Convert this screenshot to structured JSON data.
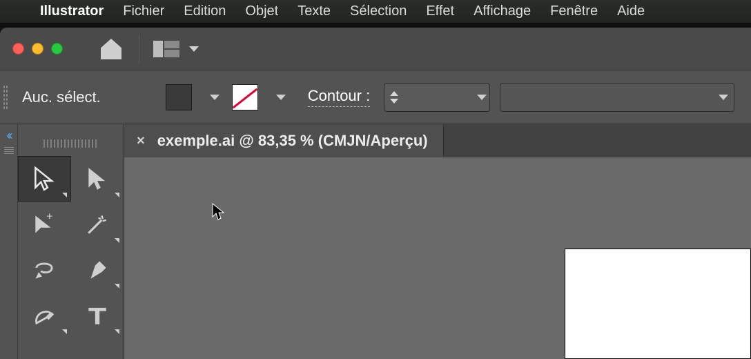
{
  "menubar": {
    "apple_glyph": "",
    "app_name": "Illustrator",
    "items": [
      "Fichier",
      "Edition",
      "Objet",
      "Texte",
      "Sélection",
      "Effet",
      "Affichage",
      "Fenêtre",
      "Aide"
    ]
  },
  "controlbar": {
    "selection_label": "Auc. sélect.",
    "contour_label": "Contour :"
  },
  "sidebar": {
    "collapse_glyph": "‹‹"
  },
  "document": {
    "tab_close_glyph": "×",
    "tab_title": "exemple.ai @ 83,35 % (CMJN/Aperçu)"
  },
  "tools": [
    {
      "name": "selection-tool",
      "selected": true
    },
    {
      "name": "direct-selection-tool",
      "selected": false
    },
    {
      "name": "group-selection-tool",
      "selected": false
    },
    {
      "name": "magic-wand-tool",
      "selected": false
    },
    {
      "name": "lasso-tool",
      "selected": false
    },
    {
      "name": "pen-tool",
      "selected": false
    },
    {
      "name": "curvature-tool",
      "selected": false
    },
    {
      "name": "type-tool",
      "selected": false
    }
  ]
}
